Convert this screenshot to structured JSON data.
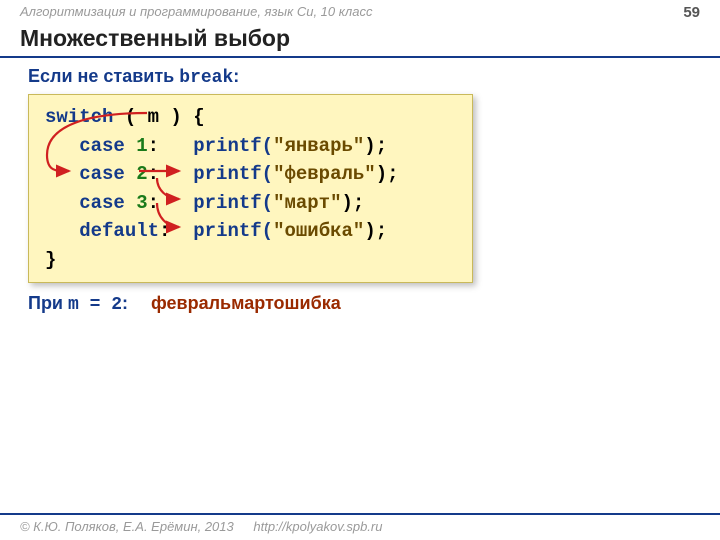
{
  "header": {
    "course": "Алгоритмизация и программирование, язык Си, 10 класс",
    "page": "59"
  },
  "title": "Множественный выбор",
  "intro_prefix": "Если не ставить ",
  "intro_kw": "break",
  "intro_suffix": ":",
  "code": {
    "l1_kw": "switch",
    "l1_rest": " ( m ) {",
    "l2_indent": "   ",
    "l2_kw": "case",
    "l2_num": " 1",
    "l2_colon": ":   ",
    "l2_fn": "printf(",
    "l2_str": "\"январь\"",
    "l2_end": ");",
    "l3_kw": "case",
    "l3_num": " 2",
    "l3_colon": ":   ",
    "l3_fn": "printf(",
    "l3_str": "\"февраль\"",
    "l3_end": ");",
    "l4_kw": "case",
    "l4_num": " 3",
    "l4_colon": ":   ",
    "l4_fn": "printf(",
    "l4_str": "\"март\"",
    "l4_end": ");",
    "l5_kw": "default",
    "l5_colon": ":  ",
    "l5_fn": "printf(",
    "l5_str": "\"ошибка\"",
    "l5_end": ");",
    "l6": "}"
  },
  "result": {
    "label_prefix": "При ",
    "label_mono": "m = 2",
    "label_suffix": ":",
    "output": "февральмартошибка"
  },
  "footer": {
    "copyright": "© К.Ю. Поляков, Е.А. Ерёмин, 2013",
    "url": "http://kpolyakov.spb.ru"
  }
}
